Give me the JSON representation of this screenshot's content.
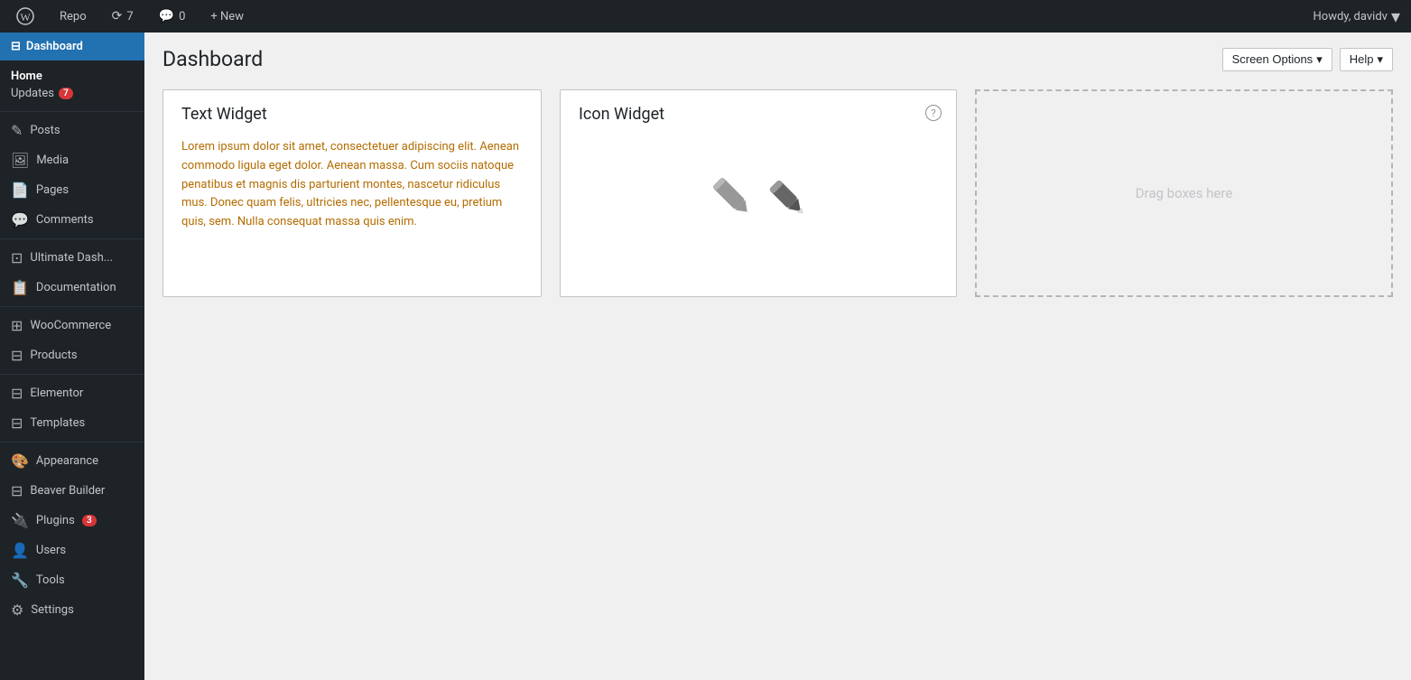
{
  "admin_bar": {
    "wp_logo": "⊞",
    "site_name": "Repo",
    "updates_count": "7",
    "comments_count": "0",
    "new_label": "+ New",
    "howdy": "Howdy, davidv"
  },
  "sidebar": {
    "active_item": "Dashboard",
    "home_label": "Home",
    "updates_label": "Updates",
    "updates_badge": "7",
    "items": [
      {
        "id": "posts",
        "label": "Posts",
        "icon": "✎"
      },
      {
        "id": "media",
        "label": "Media",
        "icon": "⊟"
      },
      {
        "id": "pages",
        "label": "Pages",
        "icon": "🗋"
      },
      {
        "id": "comments",
        "label": "Comments",
        "icon": "💬"
      },
      {
        "id": "ultimate-dash",
        "label": "Ultimate Dash...",
        "icon": "⊡"
      },
      {
        "id": "documentation",
        "label": "Documentation",
        "icon": "⊟"
      },
      {
        "id": "woocommerce",
        "label": "WooCommerce",
        "icon": "⊞"
      },
      {
        "id": "products",
        "label": "Products",
        "icon": "⊟"
      },
      {
        "id": "elementor",
        "label": "Elementor",
        "icon": "⊟"
      },
      {
        "id": "templates",
        "label": "Templates",
        "icon": "⊟"
      },
      {
        "id": "appearance",
        "label": "Appearance",
        "icon": "🎨"
      },
      {
        "id": "beaver-builder",
        "label": "Beaver Builder",
        "icon": "⊟"
      },
      {
        "id": "plugins",
        "label": "Plugins",
        "icon": "⊟",
        "badge": "3"
      },
      {
        "id": "users",
        "label": "Users",
        "icon": "👤"
      },
      {
        "id": "tools",
        "label": "Tools",
        "icon": "🔧"
      },
      {
        "id": "settings",
        "label": "Settings",
        "icon": "⚙"
      }
    ]
  },
  "page": {
    "title": "Dashboard",
    "screen_options_label": "Screen Options",
    "help_label": "Help"
  },
  "widgets": {
    "text_widget": {
      "title": "Text Widget",
      "content": "Lorem ipsum dolor sit amet, consectetuer adipiscing elit. Aenean commodo ligula eget dolor. Aenean massa. Cum sociis natoque penatibus et magnis dis parturient montes, nascetur ridiculus mus. Donec quam felis, ultricies nec, pellentesque eu, pretium quis, sem. Nulla consequat massa quis enim."
    },
    "icon_widget": {
      "title": "Icon Widget",
      "help_char": "?"
    },
    "drag_zone": {
      "text": "Drag boxes here"
    }
  }
}
